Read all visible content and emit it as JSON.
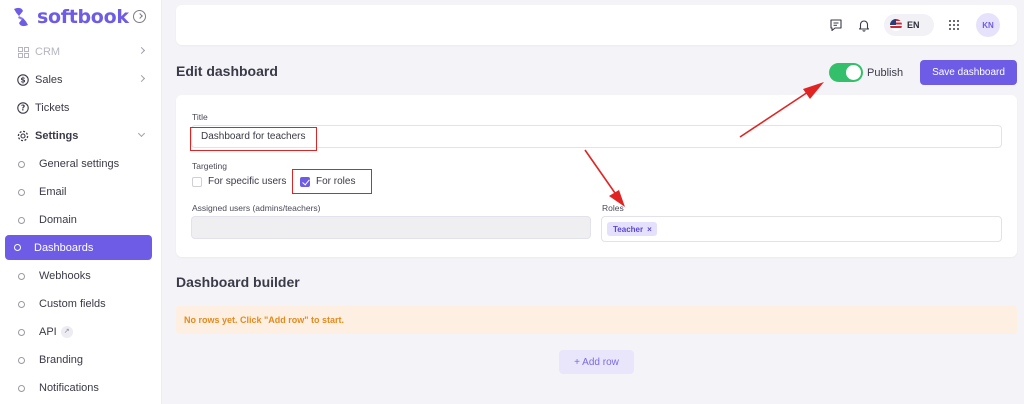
{
  "brand": {
    "name": "softbook",
    "accent": "#6e5ce6"
  },
  "sidebar": {
    "items": [
      {
        "label": "CRM",
        "icon": "grid-icon"
      },
      {
        "label": "Sales",
        "icon": "dollar-icon"
      },
      {
        "label": "Tickets",
        "icon": "help-icon"
      },
      {
        "label": "Settings",
        "icon": "gear-icon"
      }
    ],
    "settings_sub": [
      {
        "label": "General settings"
      },
      {
        "label": "Email"
      },
      {
        "label": "Domain"
      },
      {
        "label": "Dashboards"
      },
      {
        "label": "Webhooks"
      },
      {
        "label": "Custom fields"
      },
      {
        "label": "API"
      },
      {
        "label": "Branding"
      },
      {
        "label": "Notifications"
      }
    ]
  },
  "topbar": {
    "language": "EN",
    "avatar_initials": "KN"
  },
  "header": {
    "title": "Edit dashboard",
    "publish_label": "Publish",
    "publish_on": true,
    "save_label": "Save dashboard"
  },
  "form": {
    "title_label": "Title",
    "title_value": "Dashboard for teachers",
    "targeting_label": "Targeting",
    "option_users": "For specific users",
    "option_roles": "For roles",
    "assigned_label": "Assigned users (admins/teachers)",
    "roles_label": "Roles",
    "role_chip": "Teacher",
    "chip_remove": "×"
  },
  "builder": {
    "title": "Dashboard builder",
    "empty_message": "No rows yet. Click \"Add row\" to start.",
    "add_row_label": "+ Add row"
  },
  "colors": {
    "toggle_on": "#34c06a",
    "annotation_red": "#e02424",
    "warning_text": "#e48a1e",
    "warning_bg": "#fdf0e3"
  }
}
